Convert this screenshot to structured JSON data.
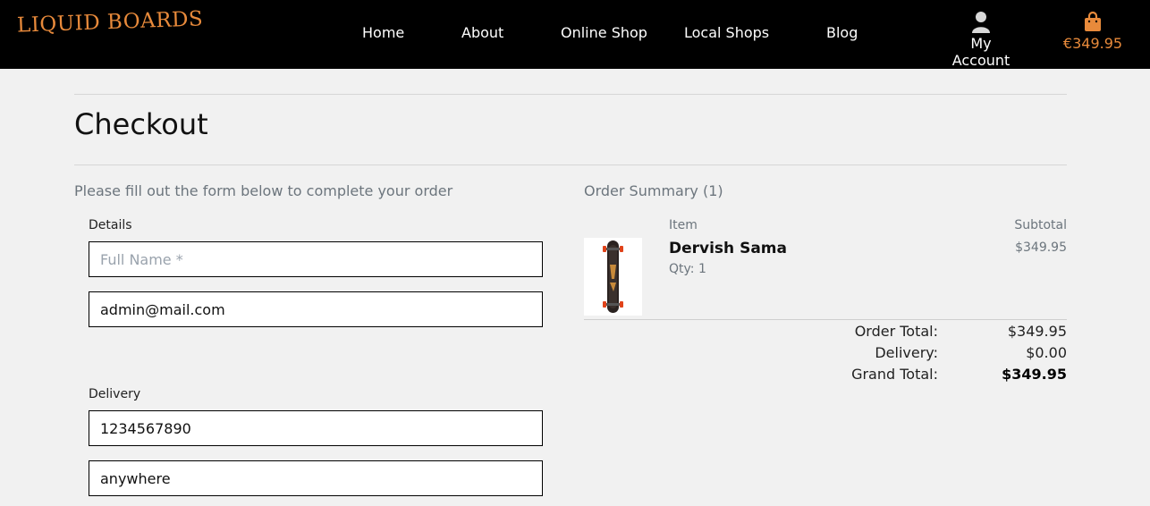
{
  "brand": {
    "logo_text": "LIQUID BOARDS",
    "accent_color": "#e88a3b"
  },
  "nav": {
    "links": [
      "Home",
      "About",
      "Online Shop",
      "Local Shops",
      "Blog"
    ],
    "account_label": "My Account",
    "account_icon": "user-icon",
    "cart_total": "€349.95",
    "cart_icon": "shopping-bag-icon"
  },
  "page": {
    "title": "Checkout",
    "intro": "Please fill out the form below to complete your order"
  },
  "form": {
    "details_label": "Details",
    "full_name": {
      "value": "",
      "placeholder": "Full Name *"
    },
    "email": {
      "value": "admin@mail.com",
      "placeholder": ""
    },
    "delivery_label": "Delivery",
    "phone": {
      "value": "1234567890",
      "placeholder": ""
    },
    "address": {
      "value": "anywhere",
      "placeholder": ""
    }
  },
  "summary": {
    "title": "Order Summary (1)",
    "item_header": "Item",
    "subtotal_header": "Subtotal",
    "items": [
      {
        "name": "Dervish Sama",
        "qty": "Qty: 1",
        "subtotal": "$349.95",
        "image_icon": "longboard-image"
      }
    ],
    "order_total_label": "Order Total:",
    "order_total": "$349.95",
    "delivery_label": "Delivery:",
    "delivery": "$0.00",
    "grand_total_label": "Grand Total:",
    "grand_total": "$349.95"
  }
}
